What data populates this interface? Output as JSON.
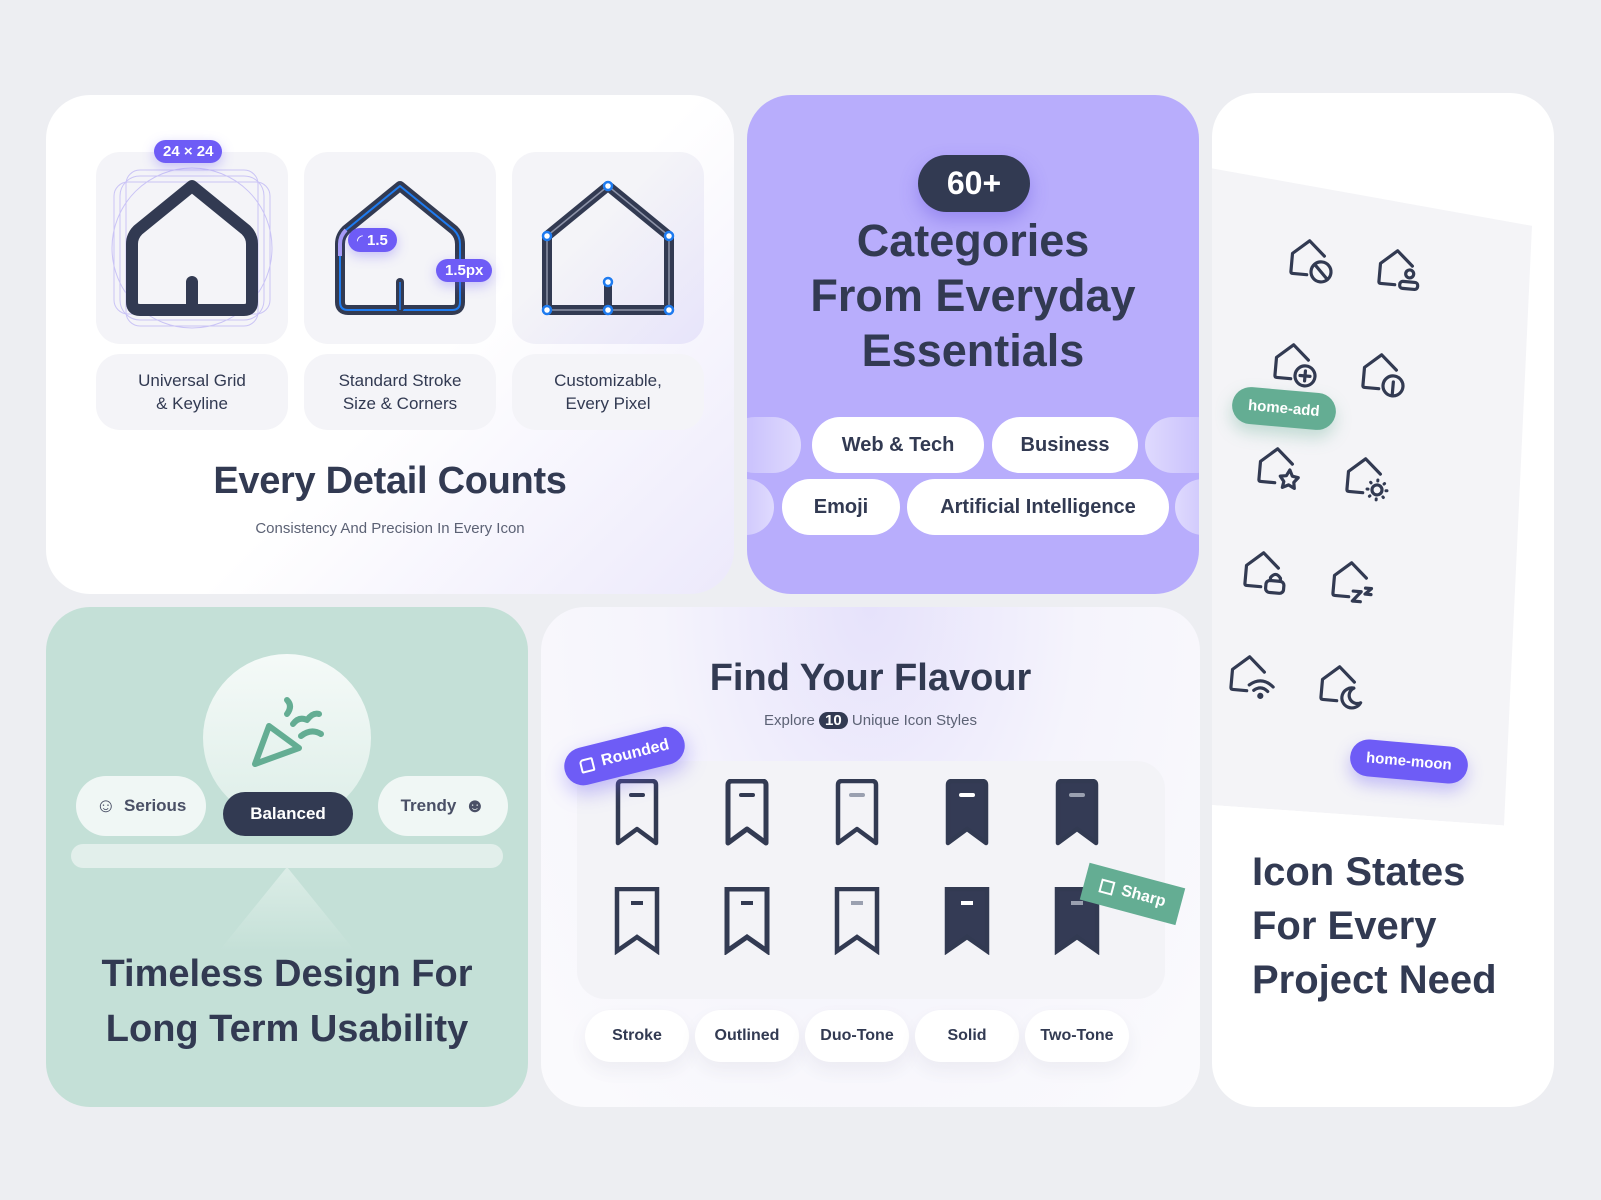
{
  "colors": {
    "background": "#edeef2",
    "ink": "#323a52",
    "accent_purple": "#6e5cf6",
    "lavender": "#b8adfc",
    "mint": "#c4e0d7",
    "green": "#64ad93",
    "keyline_blue": "#1e7bf0"
  },
  "detail_card": {
    "title": "Every Detail Counts",
    "subtitle": "Consistency And Precision In Every Icon",
    "features": [
      {
        "icon": "home-keyline-icon",
        "badge": "24 × 24",
        "caption_line1": "Universal Grid",
        "caption_line2": "& Keyline"
      },
      {
        "icon": "home-stroke-icon",
        "badge_corner": "1.5",
        "badge_stroke": "1.5px",
        "caption_line1": "Standard Stroke",
        "caption_line2": "Size & Corners"
      },
      {
        "icon": "home-nodes-icon",
        "caption_line1": "Customizable,",
        "caption_line2": "Every Pixel"
      }
    ]
  },
  "categories_card": {
    "count": "60+",
    "headline_line1": "Categories",
    "headline_line2": "From Everyday",
    "headline_line3": "Essentials",
    "chips": [
      "Web & Tech",
      "Business",
      "Emoji",
      "Artificial Intelligence"
    ]
  },
  "states_card": {
    "icons": [
      "home-block-icon",
      "home-user-icon",
      "home-add-icon",
      "home-leaf-icon",
      "home-star-icon",
      "home-sun-icon",
      "home-lock-icon",
      "home-sleep-icon",
      "home-wifi-icon",
      "home-moon-icon"
    ],
    "tag_green": "home-add",
    "tag_purple": "home-moon",
    "headline_line1": "Icon States",
    "headline_line2": "For Every",
    "headline_line3": "Project Need"
  },
  "timeless_card": {
    "options": {
      "left": "Serious",
      "center": "Balanced",
      "right": "Trendy"
    },
    "selected": "Balanced",
    "headline_line1": "Timeless Design For",
    "headline_line2": "Long Term Usability"
  },
  "flavour_card": {
    "title": "Find Your Flavour",
    "subtitle_prefix": "Explore",
    "subtitle_count": "10",
    "subtitle_suffix": "Unique Icon Styles",
    "badge_rounded": "Rounded",
    "badge_sharp": "Sharp",
    "styles": [
      "Stroke",
      "Outlined",
      "Duo-Tone",
      "Solid",
      "Two-Tone"
    ],
    "rows": [
      "rounded",
      "sharp"
    ]
  }
}
